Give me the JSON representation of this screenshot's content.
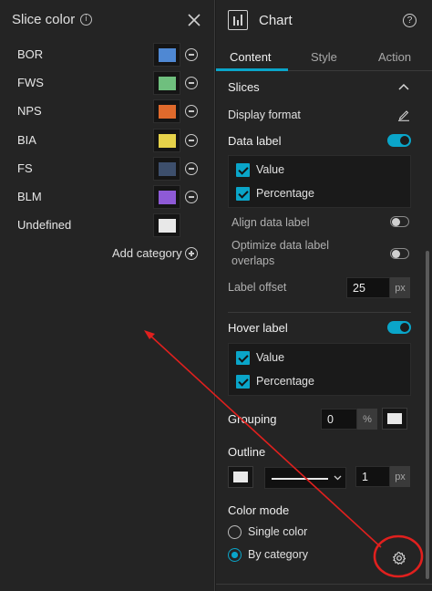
{
  "slice_panel": {
    "title": "Slice color",
    "categories": [
      {
        "label": "BOR",
        "color": "#4f88d3"
      },
      {
        "label": "FWS",
        "color": "#6fbf7e"
      },
      {
        "label": "NPS",
        "color": "#e06a2c"
      },
      {
        "label": "BIA",
        "color": "#e6d24a"
      },
      {
        "label": "FS",
        "color": "#3d4f6c"
      },
      {
        "label": "BLM",
        "color": "#8e5ad6"
      }
    ],
    "undefined_label": "Undefined",
    "undefined_color": "#e8e8e8",
    "add_category_label": "Add category"
  },
  "chart_panel": {
    "title": "Chart",
    "tabs": [
      {
        "label": "Content",
        "active": true
      },
      {
        "label": "Style",
        "active": false
      },
      {
        "label": "Action",
        "active": false
      }
    ],
    "slices_label": "Slices",
    "display_format_label": "Display format",
    "data_label": {
      "title": "Data label",
      "enabled": true,
      "options": [
        {
          "label": "Value",
          "checked": true
        },
        {
          "label": "Percentage",
          "checked": true
        }
      ]
    },
    "align_data_label": "Align data label",
    "optimize_line1": "Optimize data label",
    "optimize_line2": "overlaps",
    "label_offset": {
      "label": "Label offset",
      "value": "25",
      "unit": "px"
    },
    "hover_label": {
      "title": "Hover label",
      "enabled": true,
      "options": [
        {
          "label": "Value",
          "checked": true
        },
        {
          "label": "Percentage",
          "checked": true
        }
      ]
    },
    "grouping": {
      "label": "Grouping",
      "value": "0",
      "unit": "%"
    },
    "outline": {
      "label": "Outline",
      "width": "1",
      "unit": "px"
    },
    "color_mode": {
      "label": "Color mode",
      "options": [
        {
          "label": "Single color",
          "selected": false
        },
        {
          "label": "By category",
          "selected": true
        }
      ]
    }
  },
  "colors": {
    "accent": "#0aa5c9",
    "annotation": "#e0201e"
  }
}
